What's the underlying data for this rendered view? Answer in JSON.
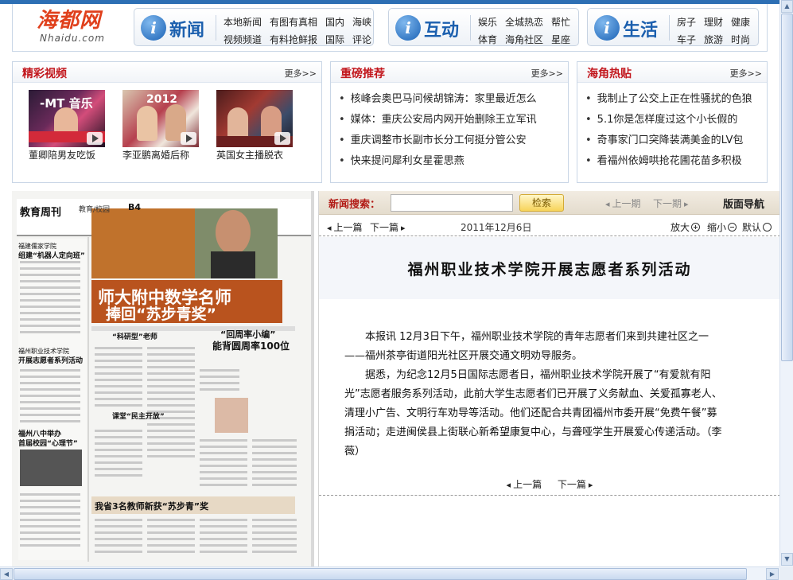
{
  "logo": {
    "cn": "海都网",
    "en": "Nhaidu.com"
  },
  "nav": [
    {
      "icon": "info-icon",
      "badge": "i",
      "title": "新闻",
      "rows": [
        [
          "本地新闻",
          "有图有真相",
          "国内",
          "海峡"
        ],
        [
          "视频频道",
          "有料抢鲜报",
          "国际",
          "评论"
        ]
      ]
    },
    {
      "icon": "info-icon",
      "badge": "i",
      "title": "互动",
      "rows": [
        [
          "娱乐",
          "全城热恋",
          "帮忙"
        ],
        [
          "体育",
          "海角社区",
          "星座"
        ]
      ]
    },
    {
      "icon": "info-icon",
      "badge": "i",
      "title": "生活",
      "rows": [
        [
          "房子",
          "理财",
          "健康"
        ],
        [
          "车子",
          "旅游",
          "时尚"
        ]
      ]
    }
  ],
  "boxes": {
    "video": {
      "title": "精彩视频",
      "more": "更多>>",
      "items": [
        {
          "caption": "董卿陪男友吃饭",
          "thumb_text": "-MT 音乐"
        },
        {
          "caption": "李亚鹏离婚后称",
          "thumb_text": "2012"
        },
        {
          "caption": "英国女主播脱衣",
          "thumb_text": ""
        }
      ]
    },
    "recommend": {
      "title": "重磅推荐",
      "more": "更多>>",
      "items": [
        "核峰会奥巴马问候胡锦涛：家里最近怎么",
        "媒体：重庆公安局内网开始删除王立军讯",
        "重庆调整市长副市长分工何挺分管公安",
        "快来提问犀利女星霍思燕"
      ]
    },
    "hot": {
      "title": "海角热贴",
      "more": "更多>>",
      "items": [
        "我制止了公交上正在性骚扰的色狼",
        "5.1你是怎样度过这个小长假的",
        "奇事家门口突降装满美金的LV包",
        "看福州依姆哄抢花圃花苗多积极"
      ]
    }
  },
  "search": {
    "label": "新闻搜索：",
    "value": "",
    "button": "检索",
    "prev": "上一期",
    "next": "下一期",
    "layout_nav": "版面导航"
  },
  "toolbar": {
    "prev": "上一篇",
    "next": "下一篇",
    "date": "2011年12月6日",
    "zoom_in": "放大",
    "zoom_out": "缩小",
    "default": "默认"
  },
  "article": {
    "title": "福州职业技术学院开展志愿者系列活动",
    "paragraphs": [
      "本报讯 12月3日下午，福州职业技术学院的青年志愿者们来到共建社区之一——福州茶亭街道阳光社区开展交通文明劝导服务。",
      "据悉，为纪念12月5日国际志愿者日，福州职业技术学院开展了“有爱就有阳光”志愿者服务系列活动，此前大学生志愿者们已开展了义务献血、关爱孤寡老人、清理小广告、文明行车劝导等活动。他们还配合共青团福州市委开展“免费午餐”募捐活动；走进闽侯县上街联心新希望康复中心，与聋哑学生开展爱心传递活动。（李薇）"
    ],
    "bottom_prev": "上一篇",
    "bottom_next": "下一篇"
  },
  "paper": {
    "masthead": "教育周刊",
    "page_no": "B4",
    "section": "教育/校园",
    "headline1": "师大附中数学名师",
    "headline2": "捧回“苏步青奖”",
    "sub1": "“回周率小编”",
    "sub2": "能背圆周率100位",
    "tag1": "“科研型”老师",
    "tag2": "课堂“民主开放”",
    "bottom_headline": "我省3名教师新获“苏步青”奖",
    "left_h1": "福建儒家学院",
    "left_h2": "组建“机器人定向班”",
    "left_h3": "福州职业技术学院",
    "left_h4": "开展志愿者系列活动",
    "left_h5": "福州八中举办",
    "left_h6": "首届校园“心理节”"
  }
}
